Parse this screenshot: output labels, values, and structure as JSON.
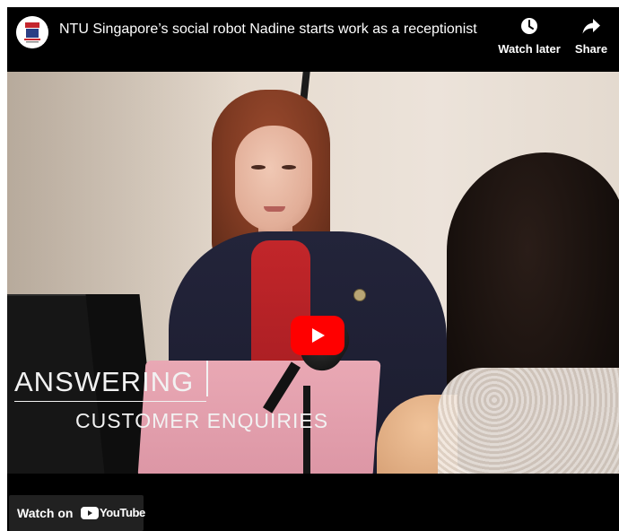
{
  "player": {
    "title": "NTU Singapore’s social robot Nadine starts work as a receptionist",
    "channel_logo_icon": "university-crest-icon",
    "actions": {
      "watch_later_label": "Watch later",
      "share_label": "Share"
    },
    "caption": {
      "line1": "ANSWERING",
      "line2": "CUSTOMER ENQUIRIES"
    },
    "play_icon": "play-icon",
    "watch_on": {
      "label": "Watch on",
      "brand": "YouTube"
    }
  },
  "colors": {
    "play_button": "#ff0000",
    "player_background": "#000000",
    "watch_on_background": "#212121"
  }
}
